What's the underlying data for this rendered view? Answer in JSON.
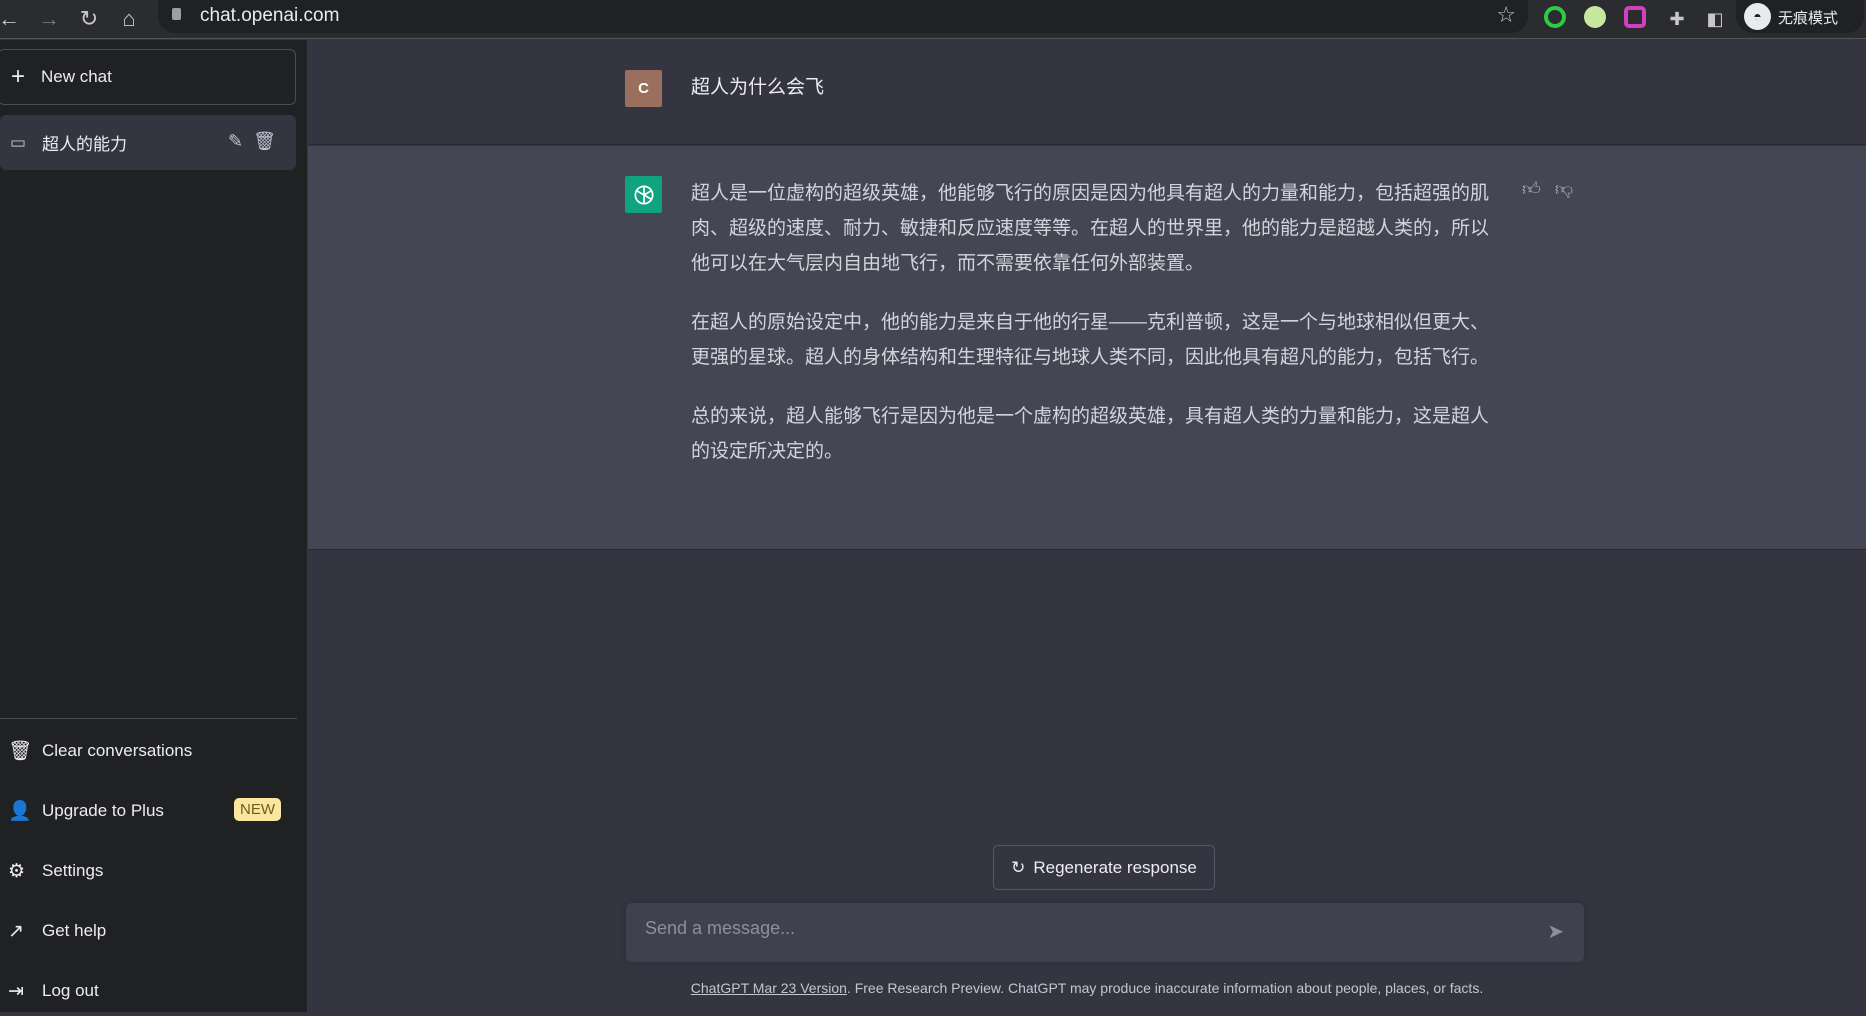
{
  "browser": {
    "url": "chat.openai.com",
    "profile_label": "无痕模式"
  },
  "sidebar": {
    "new_chat": "New chat",
    "chats": [
      {
        "title": "超人的能力"
      }
    ],
    "menu": [
      {
        "label": "Clear conversations",
        "icon": "trash-icon"
      },
      {
        "label": "Upgrade to Plus",
        "icon": "user-icon",
        "badge": "NEW"
      },
      {
        "label": "Settings",
        "icon": "gear-icon"
      },
      {
        "label": "Get help",
        "icon": "external-link-icon"
      },
      {
        "label": "Log out",
        "icon": "logout-icon"
      }
    ]
  },
  "conversation": {
    "user": {
      "avatar": "C",
      "message": "超人为什么会飞"
    },
    "assistant": {
      "paragraphs": [
        "超人是一位虚构的超级英雄，他能够飞行的原因是因为他具有超人的力量和能力，包括超强的肌肉、超级的速度、耐力、敏捷和反应速度等等。在超人的世界里，他的能力是超越人类的，所以他可以在大气层内自由地飞行，而不需要依靠任何外部装置。",
        "在超人的原始设定中，他的能力是来自于他的行星——克利普顿，这是一个与地球相似但更大、更强的星球。超人的身体结构和生理特征与地球人类不同，因此他具有超凡的能力，包括飞行。",
        "总的来说，超人能够飞行是因为他是一个虚构的超级英雄，具有超人类的力量和能力，这是超人的设定所决定的。"
      ]
    }
  },
  "regenerate_label": "Regenerate response",
  "input": {
    "placeholder": "Send a message...",
    "value": ""
  },
  "footer": {
    "link": "ChatGPT Mar 23 Version",
    "text": ". Free Research Preview. ChatGPT may produce inaccurate information about people, places, or facts."
  },
  "colors": {
    "sidebar": "#202123",
    "main": "#343541",
    "assistant_row": "#444654",
    "brand": "#10a37f",
    "badge": "#fae69e"
  }
}
